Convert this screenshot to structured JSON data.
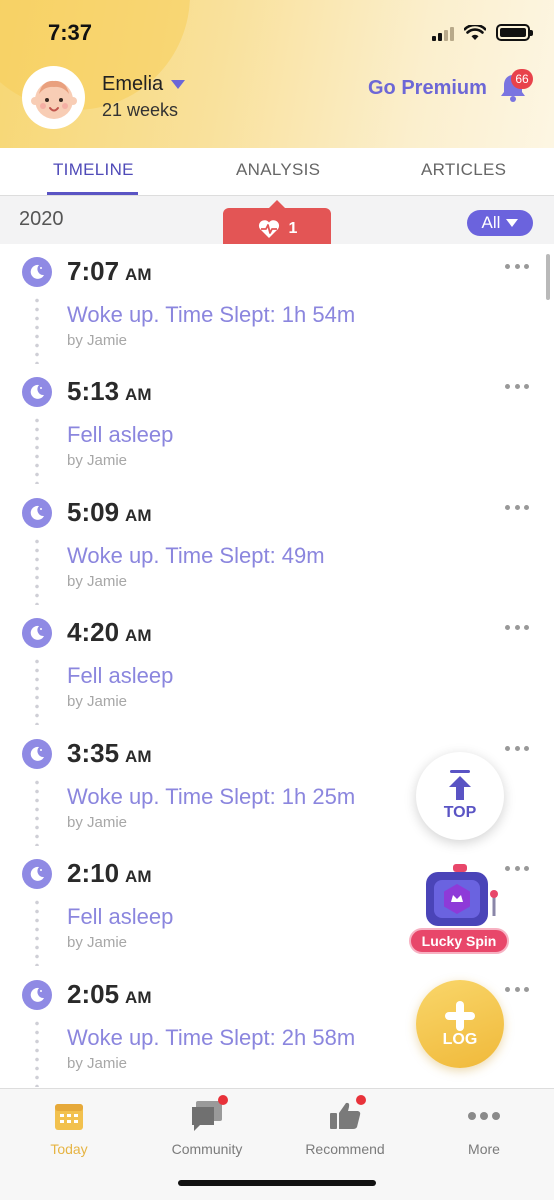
{
  "status_bar": {
    "time": "7:37"
  },
  "header": {
    "baby_name": "Emelia",
    "baby_age": "21 weeks",
    "premium_label": "Go Premium",
    "notification_count": "66"
  },
  "tabs": [
    {
      "label": "TIMELINE",
      "active": true
    },
    {
      "label": "ANALYSIS",
      "active": false
    },
    {
      "label": "ARTICLES",
      "active": false
    }
  ],
  "year_bar": {
    "year": "2020",
    "filter_label": "All",
    "heart_count": "1"
  },
  "timeline": [
    {
      "time": "7:07",
      "ampm": "AM",
      "event": "Woke up. Time Slept: 1h 54m",
      "by": "by Jamie"
    },
    {
      "time": "5:13",
      "ampm": "AM",
      "event": "Fell asleep",
      "by": "by Jamie"
    },
    {
      "time": "5:09",
      "ampm": "AM",
      "event": "Woke up. Time Slept: 49m",
      "by": "by Jamie"
    },
    {
      "time": "4:20",
      "ampm": "AM",
      "event": "Fell asleep",
      "by": "by Jamie"
    },
    {
      "time": "3:35",
      "ampm": "AM",
      "event": "Woke up. Time Slept: 1h 25m",
      "by": "by Jamie"
    },
    {
      "time": "2:10",
      "ampm": "AM",
      "event": "Fell asleep",
      "by": "by Jamie"
    },
    {
      "time": "2:05",
      "ampm": "AM",
      "event": "Woke up. Time Slept: 2h 58m",
      "by": "by Jamie"
    }
  ],
  "floating": {
    "top_label": "TOP",
    "lucky_label": "Lucky Spin",
    "log_label": "LOG"
  },
  "bottom_nav": [
    {
      "label": "Today",
      "icon": "calendar-icon",
      "active": true
    },
    {
      "label": "Community",
      "icon": "chat-icon",
      "active": false
    },
    {
      "label": "Recommend",
      "icon": "thumbs-up-icon",
      "active": false
    },
    {
      "label": "More",
      "icon": "more-icon",
      "active": false
    }
  ],
  "colors": {
    "accent": "#5a54c4",
    "event_text": "#8b86de",
    "log_button": "#f0b93a",
    "badge_red": "#e8424b"
  }
}
